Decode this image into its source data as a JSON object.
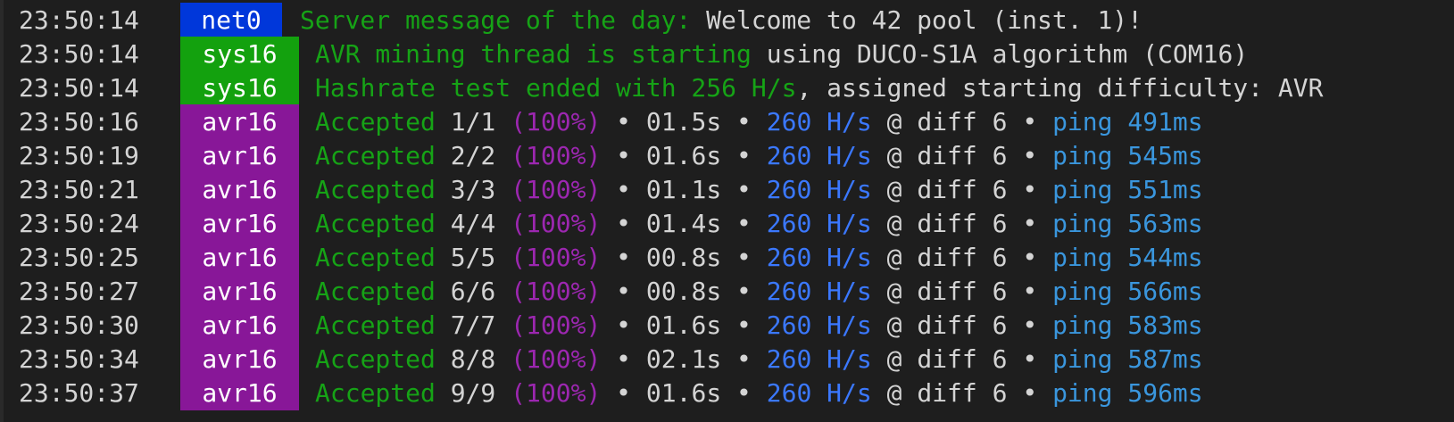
{
  "terminal": {
    "lines": [
      {
        "time": "23:50:14",
        "tag": "net0",
        "parts": [
          "Server message of the day:",
          " Welcome to 42 pool (inst. 1)!"
        ]
      },
      {
        "time": "23:50:14",
        "tag": "sys16",
        "parts": [
          "AVR mining thread is starting",
          " using DUCO-S1A algorithm (COM16)"
        ]
      },
      {
        "time": "23:50:14",
        "tag": "sys16",
        "parts": [
          "Hashrate test ended with 256 H/s",
          ", assigned starting difficulty: AVR"
        ]
      },
      {
        "time": "23:50:16",
        "tag": "avr16",
        "accepted": "Accepted",
        "count": " 1/1 ",
        "pct": "(100%)",
        "dur": " • 01.5s • ",
        "rate": "260 H/s",
        "diff": " @ diff 6 • ",
        "ping": "ping 491ms"
      },
      {
        "time": "23:50:19",
        "tag": "avr16",
        "accepted": "Accepted",
        "count": " 2/2 ",
        "pct": "(100%)",
        "dur": " • 01.6s • ",
        "rate": "260 H/s",
        "diff": " @ diff 6 • ",
        "ping": "ping 545ms"
      },
      {
        "time": "23:50:21",
        "tag": "avr16",
        "accepted": "Accepted",
        "count": " 3/3 ",
        "pct": "(100%)",
        "dur": " • 01.1s • ",
        "rate": "260 H/s",
        "diff": " @ diff 6 • ",
        "ping": "ping 551ms"
      },
      {
        "time": "23:50:24",
        "tag": "avr16",
        "accepted": "Accepted",
        "count": " 4/4 ",
        "pct": "(100%)",
        "dur": " • 01.4s • ",
        "rate": "260 H/s",
        "diff": " @ diff 6 • ",
        "ping": "ping 563ms"
      },
      {
        "time": "23:50:25",
        "tag": "avr16",
        "accepted": "Accepted",
        "count": " 5/5 ",
        "pct": "(100%)",
        "dur": " • 00.8s • ",
        "rate": "260 H/s",
        "diff": " @ diff 6 • ",
        "ping": "ping 544ms"
      },
      {
        "time": "23:50:27",
        "tag": "avr16",
        "accepted": "Accepted",
        "count": " 6/6 ",
        "pct": "(100%)",
        "dur": " • 00.8s • ",
        "rate": "260 H/s",
        "diff": " @ diff 6 • ",
        "ping": "ping 566ms"
      },
      {
        "time": "23:50:30",
        "tag": "avr16",
        "accepted": "Accepted",
        "count": " 7/7 ",
        "pct": "(100%)",
        "dur": " • 01.6s • ",
        "rate": "260 H/s",
        "diff": " @ diff 6 • ",
        "ping": "ping 583ms"
      },
      {
        "time": "23:50:34",
        "tag": "avr16",
        "accepted": "Accepted",
        "count": " 8/8 ",
        "pct": "(100%)",
        "dur": " • 02.1s • ",
        "rate": "260 H/s",
        "diff": " @ diff 6 • ",
        "ping": "ping 587ms"
      },
      {
        "time": "23:50:37",
        "tag": "avr16",
        "accepted": "Accepted",
        "count": " 9/9 ",
        "pct": "(100%)",
        "dur": " • 01.6s • ",
        "rate": "260 H/s",
        "diff": " @ diff 6 • ",
        "ping": "ping 596ms"
      }
    ]
  },
  "colors": {
    "background": "#1e1e1e",
    "net_tag": "#0037da",
    "sys_tag": "#13a10e",
    "avr_tag": "#881798",
    "green_text": "#16a316",
    "purple_text": "#9c27b0",
    "blue_text": "#3b78ff",
    "ping_text": "#3a96dd"
  }
}
